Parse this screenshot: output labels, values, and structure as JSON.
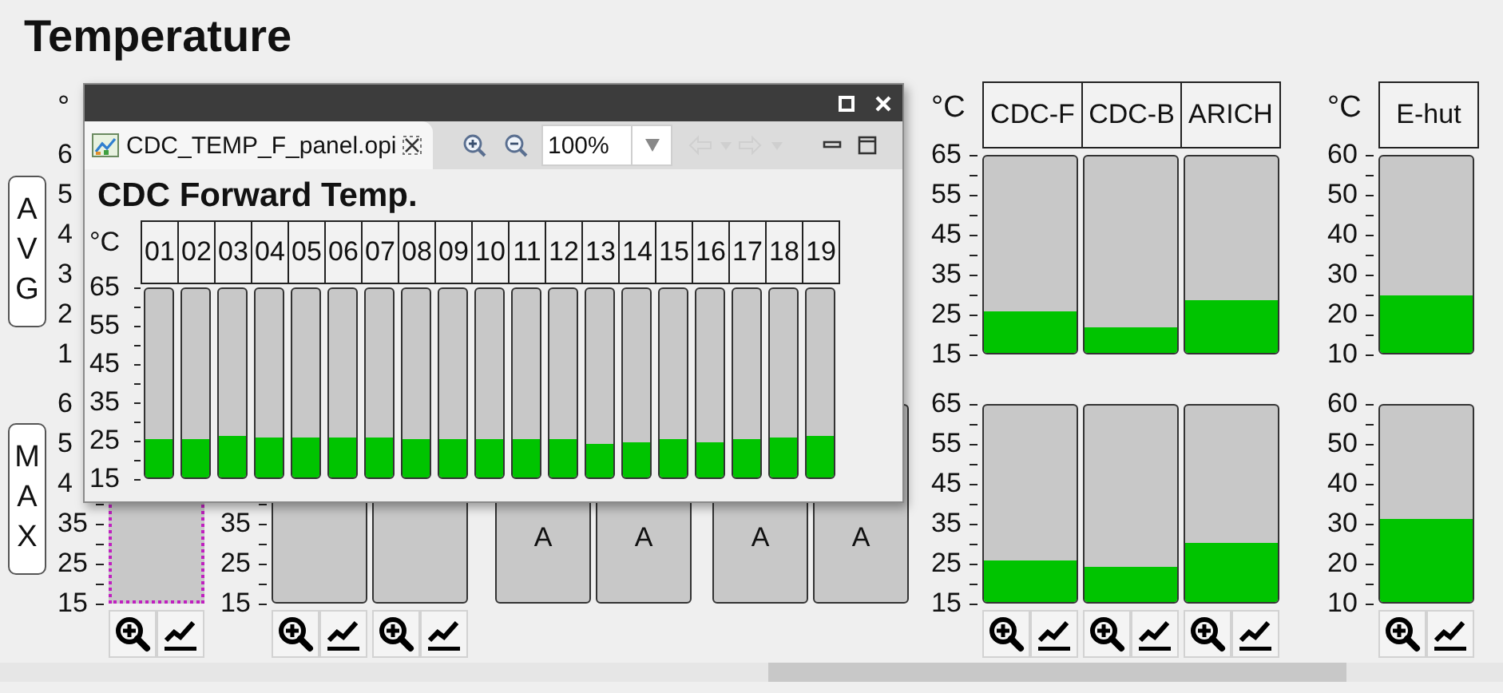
{
  "title": "Temperature",
  "side_buttons": [
    {
      "label": "AVG"
    },
    {
      "label": "MAX"
    }
  ],
  "groups": [
    {
      "unit": "°",
      "upper_scale": [
        "6",
        "5",
        "4",
        "3",
        "2",
        "1"
      ],
      "lower_scale": [
        "6",
        "5",
        "4",
        "35",
        "25",
        "15"
      ],
      "lower_bars": [
        {
          "selected": true
        }
      ],
      "buttons": true
    },
    {
      "lower_scale": [
        "35",
        "25",
        "15"
      ],
      "lower_bars": [
        {
          "selected": false
        },
        {
          "selected": false
        }
      ],
      "buttons": true
    },
    {
      "lower_bars": [
        {
          "selected": false,
          "lines": [
            "A"
          ]
        },
        {
          "selected": false,
          "lines": [
            "A"
          ]
        }
      ],
      "buttons": false
    },
    {
      "lower_bars": [
        {
          "selected": false,
          "lines": [
            "A"
          ]
        },
        {
          "selected": false,
          "lines": [
            "A"
          ]
        }
      ],
      "buttons": false
    },
    {
      "unit": "°C",
      "headers": [
        "CDC-F",
        "CDC-B",
        "ARICH"
      ],
      "upper_scale": [
        "65",
        "55",
        "45",
        "35",
        "25",
        "15"
      ],
      "upper_bars": [
        {
          "selected": false,
          "level": 0.21
        },
        {
          "selected": false,
          "level": 0.13
        },
        {
          "selected": false,
          "level": 0.27
        }
      ],
      "lower_scale": [
        "65",
        "55",
        "45",
        "35",
        "25",
        "15"
      ],
      "lower_bars": [
        {
          "selected": false,
          "level": 0.21
        },
        {
          "selected": false,
          "level": 0.18
        },
        {
          "selected": false,
          "level": 0.3
        }
      ],
      "buttons": true
    },
    {
      "unit": "°C",
      "headers": [
        "E-hut"
      ],
      "upper_scale": [
        "60",
        "50",
        "40",
        "30",
        "20",
        "10"
      ],
      "upper_bars": [
        {
          "selected": false,
          "level": 0.29
        }
      ],
      "lower_scale": [
        "60",
        "50",
        "40",
        "30",
        "20",
        "10"
      ],
      "lower_bars": [
        {
          "selected": false,
          "level": 0.42
        }
      ],
      "buttons": true
    }
  ],
  "popup": {
    "tab": {
      "label": "CDC_TEMP_F_panel.opi",
      "selected": true
    },
    "zoom": "100%",
    "heading": "CDC Forward Temp.",
    "unit": "°C",
    "scale": [
      "65",
      "55",
      "45",
      "35",
      "25",
      "15"
    ],
    "channels": [
      {
        "name": "01",
        "level": 0.2
      },
      {
        "name": "02",
        "level": 0.2
      },
      {
        "name": "03",
        "level": 0.22
      },
      {
        "name": "04",
        "level": 0.21
      },
      {
        "name": "05",
        "level": 0.21
      },
      {
        "name": "06",
        "level": 0.21
      },
      {
        "name": "07",
        "level": 0.21
      },
      {
        "name": "08",
        "level": 0.2
      },
      {
        "name": "09",
        "level": 0.2
      },
      {
        "name": "10",
        "level": 0.2
      },
      {
        "name": "11",
        "level": 0.2
      },
      {
        "name": "12",
        "level": 0.2
      },
      {
        "name": "13",
        "level": 0.18
      },
      {
        "name": "14",
        "level": 0.19
      },
      {
        "name": "15",
        "level": 0.2
      },
      {
        "name": "16",
        "level": 0.19
      },
      {
        "name": "17",
        "level": 0.2
      },
      {
        "name": "18",
        "level": 0.21
      },
      {
        "name": "19",
        "level": 0.22
      }
    ]
  }
}
